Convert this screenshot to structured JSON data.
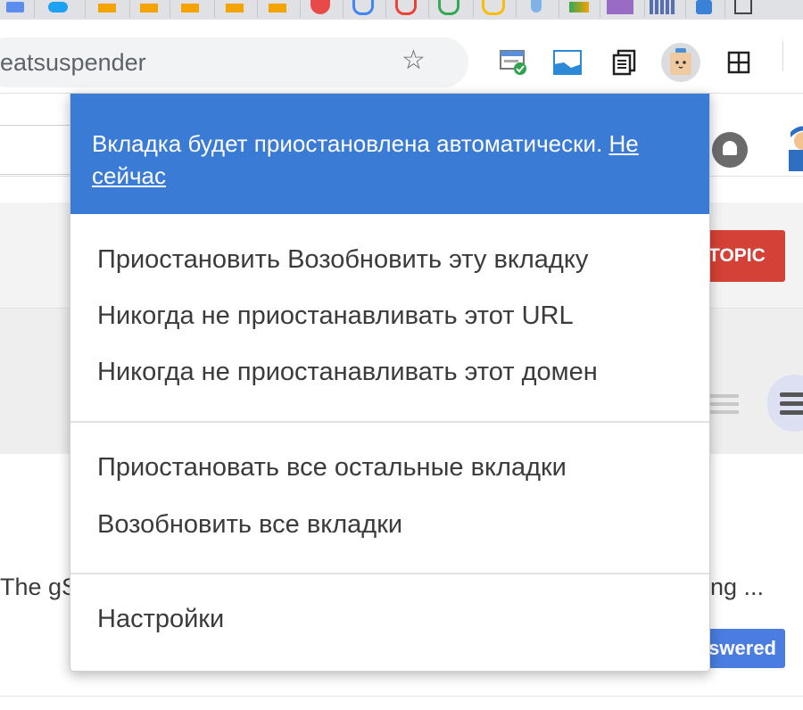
{
  "browser": {
    "address_text": "eatsuspender",
    "bookmark_colors": [
      "#5b8def",
      "#1da1f2",
      "#f4a300",
      "#f4a300",
      "#f4a300",
      "#f4a300",
      "#f4a300",
      "#e84a4a",
      "#ea4335",
      "#4285f4",
      "#34a853",
      "#fbbc05",
      "#7fb3e8",
      "#f4a300",
      "#9a6bc4",
      "#5a6fa5",
      "#3b82d6",
      "#999999"
    ],
    "extension_icons": [
      "tab-checker-icon",
      "window-icon",
      "reader-icon",
      "great-suspender-icon",
      "grid-icon"
    ]
  },
  "popup": {
    "banner": {
      "message": "Вкладка будет приостановлена автоматически.",
      "link": "Не сейчас",
      "bg_color": "#3a7bd5"
    },
    "groups": [
      [
        "Приостановить Возобновить эту вкладку",
        "Никогда не приостанавливать этот URL",
        "Никогда не приостанавливать этот домен"
      ],
      [
        "Приостановать все остальные вкладки",
        "Возобновить все вкладки"
      ],
      [
        "Настройки"
      ]
    ]
  },
  "background": {
    "topic_button": "TOPIC",
    "snippet_left": "The gS",
    "snippet_right": "ing ...",
    "answered_badge": "swered",
    "topic_color": "#d44136",
    "answered_color": "#4a7ddf"
  }
}
